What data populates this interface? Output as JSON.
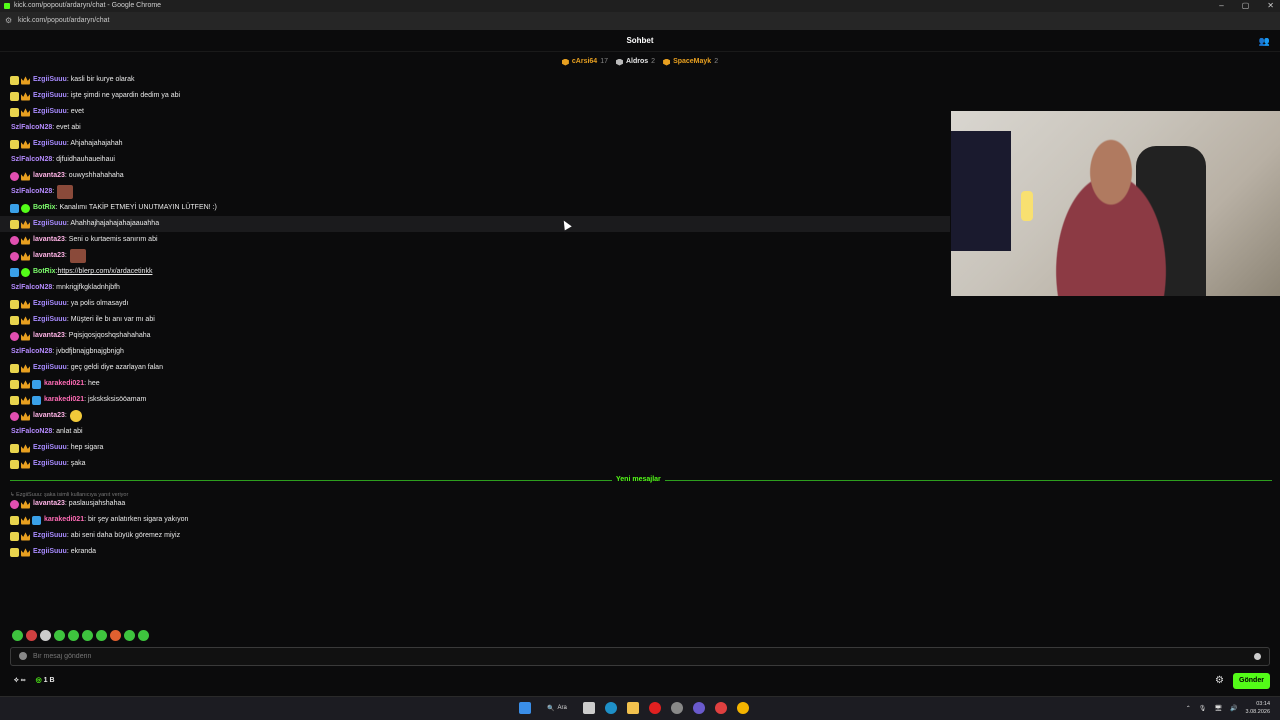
{
  "window": {
    "title": "kick.com/popout/ardaryn/chat - Google Chrome",
    "minimize": "–",
    "maximize": "▢",
    "close": "✕"
  },
  "url": "kick.com/popout/ardaryn/chat",
  "chat": {
    "title": "Sohbet"
  },
  "gifters": [
    {
      "name": "cArsi64",
      "count": "17",
      "color": "#e8a020"
    },
    {
      "name": "Aldros",
      "count": "2",
      "color": "#e8e8e8"
    },
    {
      "name": "SpaceMayk",
      "count": "2",
      "color": "#e8a020"
    }
  ],
  "messages": [
    {
      "user": "EzgiiSuuu",
      "text": ": kasli bir kurye olarak"
    },
    {
      "user": "EzgiiSuuu",
      "text": ": işte şimdi ne yapardin dedim ya abi"
    },
    {
      "user": "EzgiiSuuu",
      "text": ": evet"
    },
    {
      "user": "SzlFalcoN28",
      "text": ": evet abi"
    },
    {
      "user": "EzgiiSuuu",
      "text": ": Ahjahajahajahah"
    },
    {
      "user": "SzlFalcoN28",
      "text": ": djfuidhauhaueihaui"
    },
    {
      "user": "lavanta23",
      "text": ": ouwyshhahahaha"
    },
    {
      "user": "SzlFalcoN28",
      "text": ":"
    },
    {
      "user": "BotRix",
      "text": ": Kanalımı TAKİP ETMEYİ UNUTMAYIN LÜTFEN! :)"
    },
    {
      "user": "EzgiiSuuu",
      "text": ": Ahahhajhajahajahajaauahha"
    },
    {
      "user": "lavanta23",
      "text": ": Seni o kurtaemis sanırım abi"
    },
    {
      "user": "lavanta23",
      "text": ":"
    },
    {
      "user": "BotRix",
      "text": ": ",
      "link": "https://blerp.com/x/ardacetinkk"
    },
    {
      "user": "SzlFalcoN28",
      "text": ": mnkrigjfkgkladnhjbfh"
    },
    {
      "user": "EzgiiSuuu",
      "text": ": ya polis olmasaydı"
    },
    {
      "user": "EzgiiSuuu",
      "text": ": Müşteri ile bı anı var mı abi"
    },
    {
      "user": "lavanta23",
      "text": ": Pqisjqosjqoshqshahahaha"
    },
    {
      "user": "SzlFalcoN28",
      "text": ": jvbdfjbnajgbnajgbnjgh"
    },
    {
      "user": "EzgiiSuuu",
      "text": ": geç geldi diye azarlayan falan"
    },
    {
      "user": "karakedi021",
      "text": ": hee"
    },
    {
      "user": "karakedi021",
      "text": ": jsksksksisööamam"
    },
    {
      "user": "lavanta23",
      "text": ":"
    },
    {
      "user": "SzlFalcoN28",
      "text": ": anlat abi"
    },
    {
      "user": "EzgiiSuuu",
      "text": ": hep sigara"
    },
    {
      "user": "EzgiiSuuu",
      "text": ": şaka"
    }
  ],
  "separator": "Yeni mesajlar",
  "reply_note": "↳ EzgiiSuuu: şaka isimli kullanıcıya yanıt veriyor",
  "new_messages": [
    {
      "user": "lavanta23",
      "text": ": paslausjahshahaa"
    },
    {
      "user": "karakedi021",
      "text": ": bir şey anlatırken sigara yakıyon"
    },
    {
      "user": "EzgiiSuuu",
      "text": ": abi seni daha büyük göremez miyiz"
    },
    {
      "user": "EzgiiSuuu",
      "text": ": ekranda"
    }
  ],
  "input": {
    "placeholder": "Bir mesaj gönderin"
  },
  "footer": {
    "infinity": "∞",
    "points": "1 B",
    "send_label": "Gönder"
  },
  "taskbar": {
    "search_label": "Ara",
    "time": "03:14",
    "date": "3.08.2026"
  },
  "accent": "#53fc18"
}
